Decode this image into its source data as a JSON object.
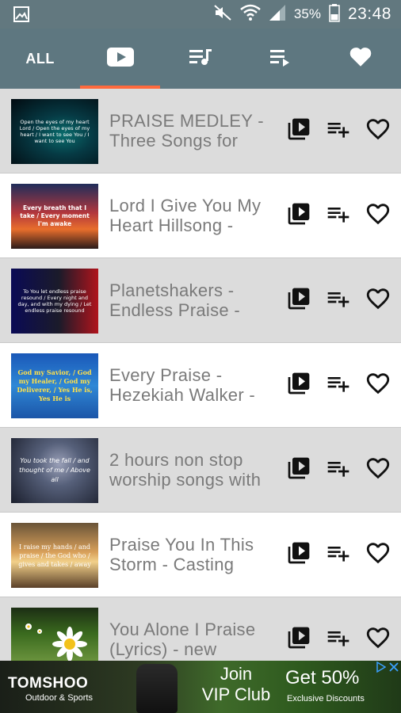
{
  "status_bar": {
    "battery_percent": "35%",
    "time": "23:48",
    "icons": [
      "gallery-icon",
      "mute-icon",
      "wifi-icon",
      "signal-icon",
      "battery-icon"
    ]
  },
  "tabs": {
    "all_label": "ALL",
    "items": [
      "all",
      "video-icon",
      "playlist-music-icon",
      "queue-icon",
      "heart-icon"
    ],
    "active_index": 1,
    "accent_color": "#ff6a3d"
  },
  "videos": [
    {
      "title": "PRAISE MEDLEY - Three Songs for",
      "thumb_text": "Open the eyes of my heart Lord / Open the eyes of my heart / I want to see You / I want to see You"
    },
    {
      "title": "Lord I Give You My Heart   Hillsong -",
      "thumb_text": "Every breath that I take / Every moment I'm awake"
    },
    {
      "title": "Planetshakers - Endless Praise -",
      "thumb_text": "To You let endless praise resound / Every night and day, and with my dying / Let endless praise resound"
    },
    {
      "title": "Every Praise - Hezekiah Walker -",
      "thumb_text": "God my Savior, / God my Healer, / God my Deliverer, / Yes He is, Yes He is"
    },
    {
      "title": "2 hours non stop worship songs with",
      "thumb_text": "You took the fall / and thought of me / Above all"
    },
    {
      "title": "Praise You In This Storm - Casting",
      "thumb_text": "I raise my hands / and praise / the God who / gives and takes / away"
    },
    {
      "title": "You Alone I Praise (Lyrics) - new",
      "thumb_text": ""
    }
  ],
  "actions": {
    "add_to_playlist_icon": "playlist-play-icon",
    "queue_icon": "playlist-add-icon",
    "favorite_icon": "heart-outline-icon"
  },
  "ad": {
    "brand": "TOMSHOO",
    "brand_sub": "Outdoor & Sports",
    "join_line1": "Join",
    "join_line2": "VIP Club",
    "offer": "Get 50%",
    "offer_sub": "Exclusive Discounts"
  }
}
